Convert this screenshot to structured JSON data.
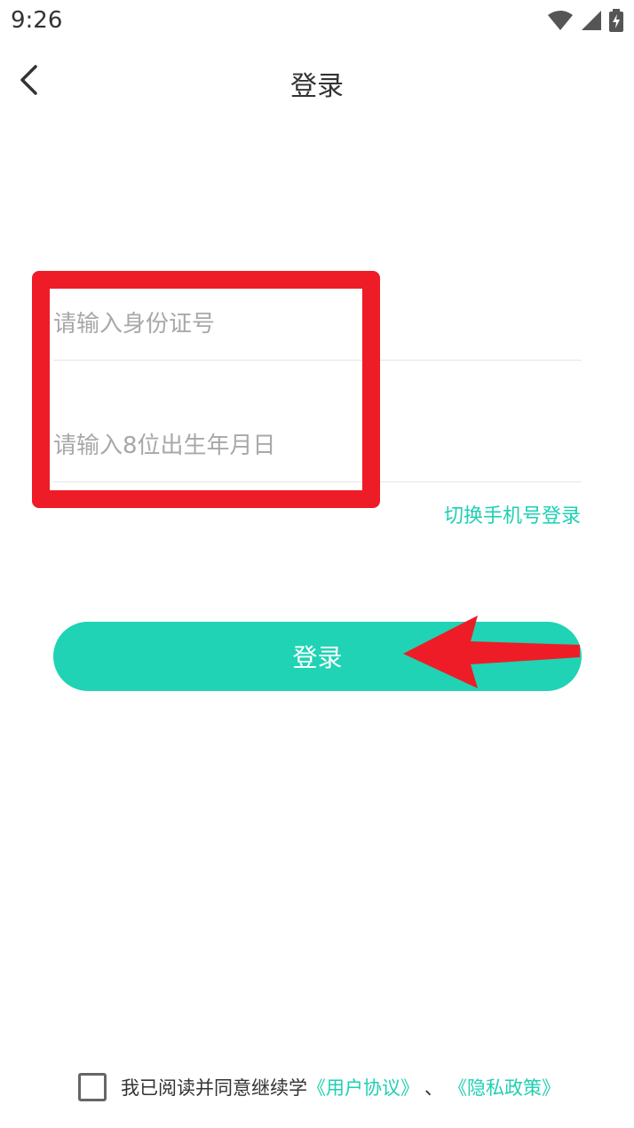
{
  "status_bar": {
    "time": "9:26"
  },
  "nav": {
    "title": "登录"
  },
  "form": {
    "id_placeholder": "请输入身份证号",
    "birth_placeholder": "请输入8位出生年月日",
    "switch_label": "切换手机号登录",
    "login_label": "登录"
  },
  "agreement": {
    "text": "我已阅读并同意继续学",
    "user_link": "《用户协议》",
    "separator": "、",
    "privacy_link": "《隐私政策》"
  },
  "colors": {
    "accent": "#1fd3b4",
    "link": "#1fcfb2",
    "annotation": "#ee1c27"
  }
}
